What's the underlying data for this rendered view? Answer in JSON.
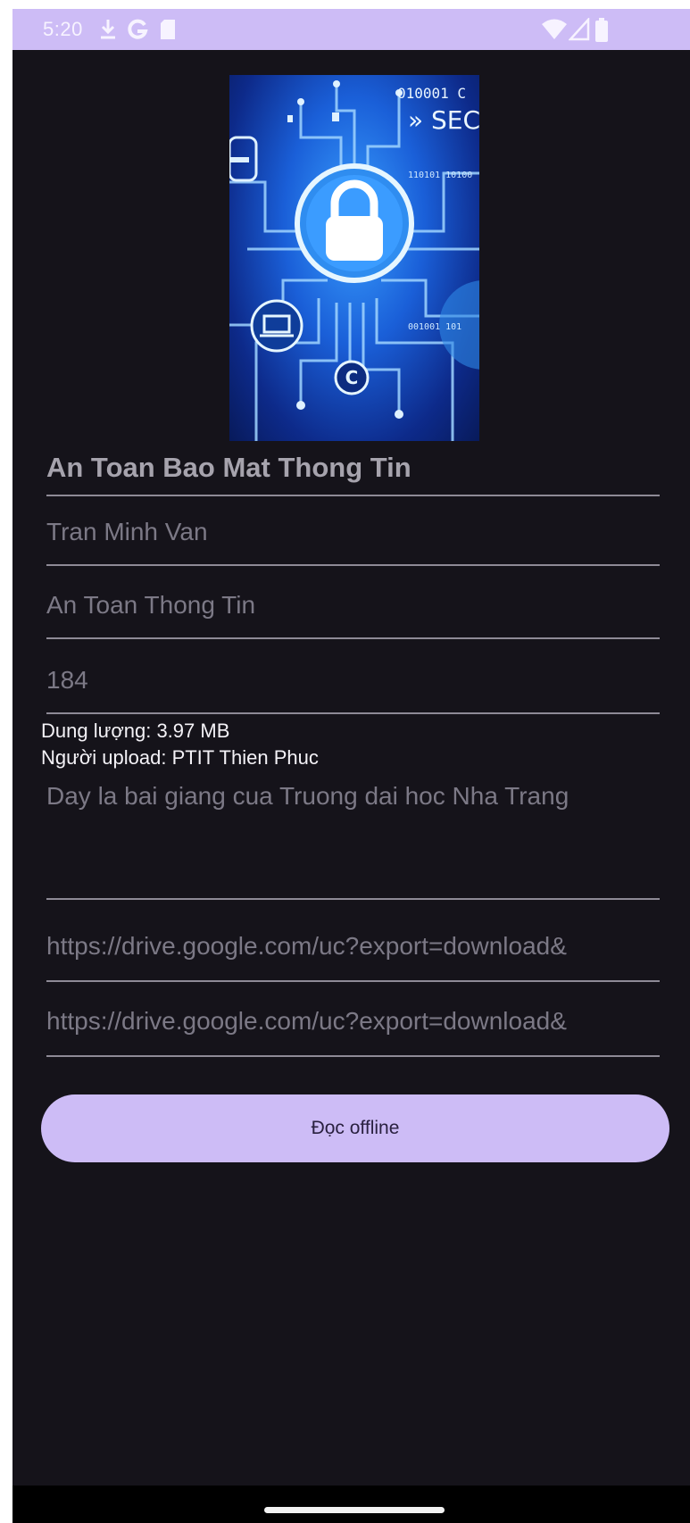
{
  "status_bar": {
    "time": "5:20",
    "icons": [
      "download-icon",
      "google-icon",
      "sd-card-icon",
      "wifi-icon",
      "signal-icon",
      "battery-icon"
    ]
  },
  "book": {
    "title": "An Toan Bao Mat Thong Tin",
    "author": "Tran Minh Van",
    "category": "An Toan Thong Tin",
    "pages": "184",
    "size_label": "Dung lượng: 3.97 MB",
    "uploader_label": "Người upload: PTIT Thien Phuc",
    "description": "Day la bai giang cua Truong dai hoc Nha Trang",
    "url_1": "https://drive.google.com/uc?export=download&",
    "url_2": "https://drive.google.com/uc?export=download&"
  },
  "cover": {
    "text_top": "010001 C",
    "text_sec": "» SEC",
    "icons": [
      "lock-icon",
      "laptop-icon",
      "copyright-icon"
    ]
  },
  "actions": {
    "read_offline": "Đọc offline"
  },
  "colors": {
    "accent": "#cdbcf6",
    "background": "#15131a",
    "field_text": "#7c7986",
    "divider": "#8e8a96"
  }
}
